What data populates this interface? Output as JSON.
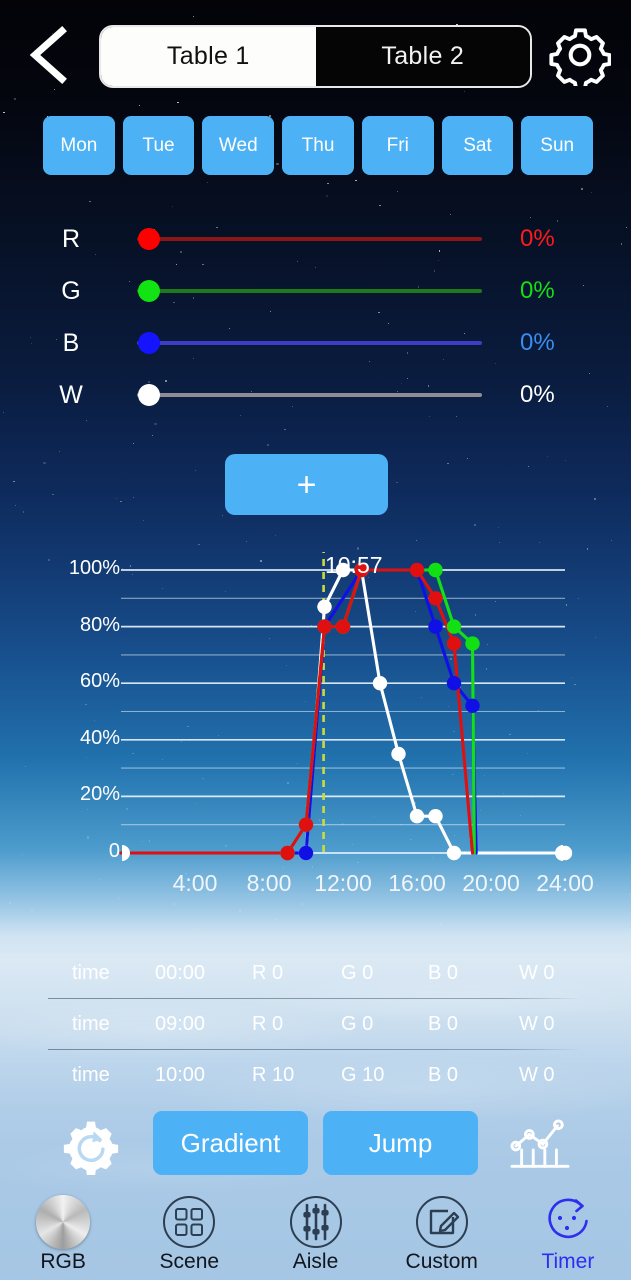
{
  "header": {
    "back_icon": "chevron-left-icon",
    "gear_icon": "gear-icon",
    "tabs": [
      {
        "label": "Table 1",
        "active": true
      },
      {
        "label": "Table 2",
        "active": false
      }
    ]
  },
  "days": [
    {
      "label": "Mon"
    },
    {
      "label": "Tue"
    },
    {
      "label": "Wed"
    },
    {
      "label": "Thu"
    },
    {
      "label": "Fri"
    },
    {
      "label": "Sat"
    },
    {
      "label": "Sun"
    }
  ],
  "sliders": [
    {
      "channel": "R",
      "value": "0%",
      "color": "#ff0000",
      "track": "#8b1616",
      "text_color": "#ff1a1a"
    },
    {
      "channel": "G",
      "value": "0%",
      "color": "#12e312",
      "track": "#1d7a1d",
      "text_color": "#17dd17"
    },
    {
      "channel": "B",
      "value": "0%",
      "color": "#1414ff",
      "track": "#3c3cc8",
      "text_color": "#3c8cf0"
    },
    {
      "channel": "W",
      "value": "0%",
      "color": "#ffffff",
      "track": "#8d8d93",
      "text_color": "#ffffff"
    }
  ],
  "add_button": {
    "label": "+"
  },
  "cursor": {
    "time_label": "10:57"
  },
  "table": {
    "rows": [
      {
        "time_label": "time",
        "time": "00:00",
        "r": "R 0",
        "g": "G 0",
        "b": "B 0",
        "w": "W 0"
      },
      {
        "time_label": "time",
        "time": "09:00",
        "r": "R 0",
        "g": "G 0",
        "b": "B 0",
        "w": "W 0"
      },
      {
        "time_label": "time",
        "time": "10:00",
        "r": "R 10",
        "g": "G 10",
        "b": "B 0",
        "w": "W 0"
      }
    ]
  },
  "actions": {
    "settings_icon": "gear-refresh-icon",
    "gradient_label": "Gradient",
    "jump_label": "Jump",
    "chart_icon": "line-chart-icon"
  },
  "nav": [
    {
      "label": "RGB",
      "icon": "color-wheel-icon",
      "active": false
    },
    {
      "label": "Scene",
      "icon": "grid-squares-icon",
      "active": false
    },
    {
      "label": "Aisle",
      "icon": "sliders-icon",
      "active": false
    },
    {
      "label": "Custom",
      "icon": "pencil-edit-icon",
      "active": false
    },
    {
      "label": "Timer",
      "icon": "timer-icon",
      "active": true
    }
  ],
  "chart_data": {
    "type": "line",
    "title": "",
    "xlabel": "",
    "ylabel": "",
    "xlim": [
      0,
      24
    ],
    "ylim": [
      0,
      100
    ],
    "grid": true,
    "grid_step": 10,
    "legend": "none",
    "y_ticks": [
      {
        "value": 100,
        "label": "100%"
      },
      {
        "value": 80,
        "label": "80%"
      },
      {
        "value": 60,
        "label": "60%"
      },
      {
        "value": 40,
        "label": "40%"
      },
      {
        "value": 20,
        "label": "20%"
      },
      {
        "value": 0,
        "label": "0"
      }
    ],
    "x_ticks": [
      {
        "value": 4,
        "label": "4:00"
      },
      {
        "value": 8,
        "label": "8:00"
      },
      {
        "value": 12,
        "label": "12:00"
      },
      {
        "value": 16,
        "label": "16:00"
      },
      {
        "value": 20,
        "label": "20:00"
      },
      {
        "value": 24,
        "label": "24:00"
      }
    ],
    "cursor_line": {
      "x": 10.95,
      "label": "10:57",
      "color": "#cddb3a",
      "style": "dashed"
    },
    "series": [
      {
        "name": "R",
        "color": "#e01010",
        "points": [
          [
            0,
            0
          ],
          [
            9,
            0
          ],
          [
            10,
            10
          ],
          [
            11,
            80
          ],
          [
            12,
            80
          ],
          [
            13,
            100
          ],
          [
            16,
            100
          ],
          [
            17,
            90
          ],
          [
            18,
            74
          ],
          [
            19,
            0
          ]
        ]
      },
      {
        "name": "G",
        "color": "#13e013",
        "points": [
          [
            0,
            0
          ],
          [
            9,
            0
          ],
          [
            10,
            10
          ],
          [
            11,
            80
          ],
          [
            12,
            80
          ],
          [
            13,
            100
          ],
          [
            17,
            100
          ],
          [
            18,
            80
          ],
          [
            19,
            74
          ],
          [
            19.1,
            0
          ]
        ]
      },
      {
        "name": "B",
        "color": "#1010e6",
        "points": [
          [
            0,
            0
          ],
          [
            9,
            0
          ],
          [
            10,
            0
          ],
          [
            11,
            80
          ],
          [
            13,
            100
          ],
          [
            16,
            100
          ],
          [
            17,
            80
          ],
          [
            18,
            60
          ],
          [
            19,
            52
          ],
          [
            19.2,
            0
          ]
        ]
      },
      {
        "name": "W",
        "color": "#ffffff",
        "points": [
          [
            0,
            0
          ],
          [
            9,
            0
          ],
          [
            10,
            0
          ],
          [
            11,
            87
          ],
          [
            12,
            100
          ],
          [
            13,
            100
          ],
          [
            14,
            60
          ],
          [
            15,
            35
          ],
          [
            16,
            13
          ],
          [
            17,
            13
          ],
          [
            18,
            0
          ],
          [
            24,
            0
          ]
        ]
      }
    ]
  }
}
